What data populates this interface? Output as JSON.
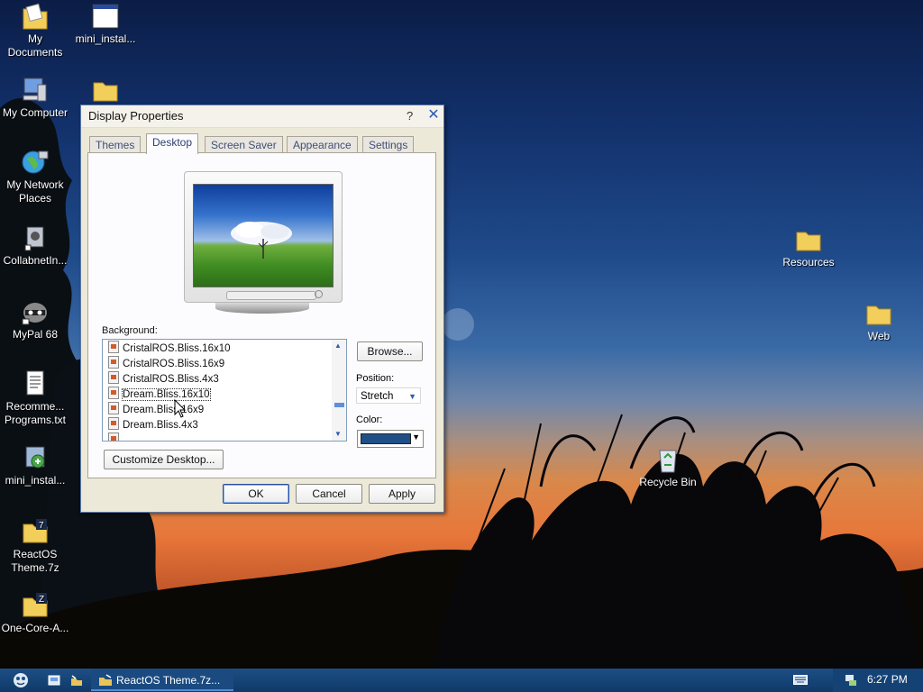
{
  "desktop": {
    "icons": [
      {
        "label": "My Documents"
      },
      {
        "label": "mini_instal..."
      },
      {
        "label": "My Computer"
      },
      {
        "label": "My Network Places"
      },
      {
        "label": "CollabnetIn..."
      },
      {
        "label": "MyPal 68"
      },
      {
        "label": "Recomme... Programs.txt"
      },
      {
        "label": "mini_instal..."
      },
      {
        "label": "ReactOS Theme.7z"
      },
      {
        "label": "One-Core-A..."
      },
      {
        "label": "Resources"
      },
      {
        "label": "Web"
      },
      {
        "label": "Recycle Bin"
      }
    ]
  },
  "window": {
    "title": "Display Properties",
    "help": "?",
    "close": "✕",
    "tabs": [
      {
        "label": "Themes"
      },
      {
        "label": "Desktop"
      },
      {
        "label": "Screen Saver"
      },
      {
        "label": "Appearance"
      },
      {
        "label": "Settings"
      }
    ],
    "active_tab": "Desktop",
    "background_label": "Background:",
    "backgrounds": [
      "CristalROS.Bliss.16x10",
      "CristalROS.Bliss.16x9",
      "CristalROS.Bliss.4x3",
      "Dream.Bliss.16x10",
      "Dream.Bliss.16x9",
      "Dream.Bliss.4x3"
    ],
    "selected_background": "Dream.Bliss.16x10",
    "browse_label": "Browse...",
    "position_label": "Position:",
    "position_value": "Stretch",
    "color_label": "Color:",
    "color_value": "#1f4f86",
    "customize_label": "Customize Desktop...",
    "ok_label": "OK",
    "cancel_label": "Cancel",
    "apply_label": "Apply"
  },
  "taskbar": {
    "task_label": "ReactOS Theme.7z...",
    "clock": "6:27 PM"
  }
}
